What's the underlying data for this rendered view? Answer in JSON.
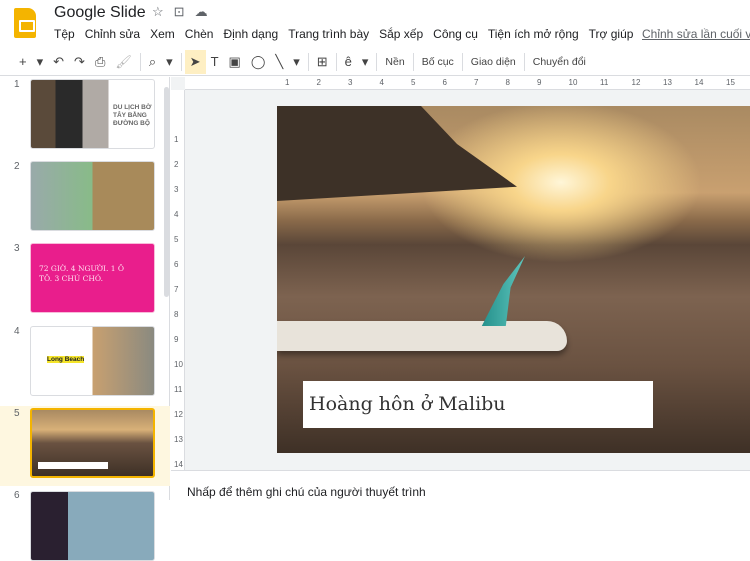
{
  "app": {
    "title": "Google Slide",
    "icons": [
      "star-icon",
      "folder-move-icon",
      "cloud-icon"
    ]
  },
  "menu": [
    "Tệp",
    "Chỉnh sửa",
    "Xem",
    "Chèn",
    "Định dạng",
    "Trang trình bày",
    "Sắp xếp",
    "Công cụ",
    "Tiện ích mở rộng",
    "Trợ giúp"
  ],
  "last_edit": "Chỉnh sửa lần cuối và",
  "toolbar": {
    "new": "+",
    "undo": "↶",
    "redo": "↷",
    "print": "⎙",
    "paint": "🖌",
    "zoom": "⌕",
    "select": "➤",
    "textbox": "T",
    "image": "▣",
    "shape": "◯",
    "line": "╲",
    "comment": "⊞",
    "input_tools": "ê",
    "background": "Nền",
    "layout": "Bố cục",
    "theme": "Giao diện",
    "transition": "Chuyển đổi",
    "dropdown": "▾"
  },
  "slides": [
    {
      "num": "1",
      "title": "DU LỊCH BỜ TÂY BẰNG ĐƯỜNG BỘ"
    },
    {
      "num": "2"
    },
    {
      "num": "3",
      "text": "72 GIỜ. 4 NGƯỜI. 1 Ô TÔ. 3 CHÚ CHÓ."
    },
    {
      "num": "4",
      "title": "Long Beach"
    },
    {
      "num": "5"
    },
    {
      "num": "6"
    }
  ],
  "ruler": {
    "h": [
      "1",
      "2",
      "3",
      "4",
      "5",
      "6",
      "7",
      "8",
      "9",
      "10",
      "11",
      "12",
      "13",
      "14",
      "15"
    ],
    "v": [
      "1",
      "2",
      "3",
      "4",
      "5",
      "6",
      "7",
      "8",
      "9",
      "10",
      "11",
      "12",
      "13",
      "14"
    ]
  },
  "current_slide": {
    "caption": "Hoàng hôn ở Malibu"
  },
  "notes": {
    "placeholder": "Nhấp để thêm ghi chú của người thuyết trình"
  },
  "colors": {
    "accent": "#f4b400",
    "selected": "#fef7e0",
    "slide3": "#e91e8c"
  }
}
